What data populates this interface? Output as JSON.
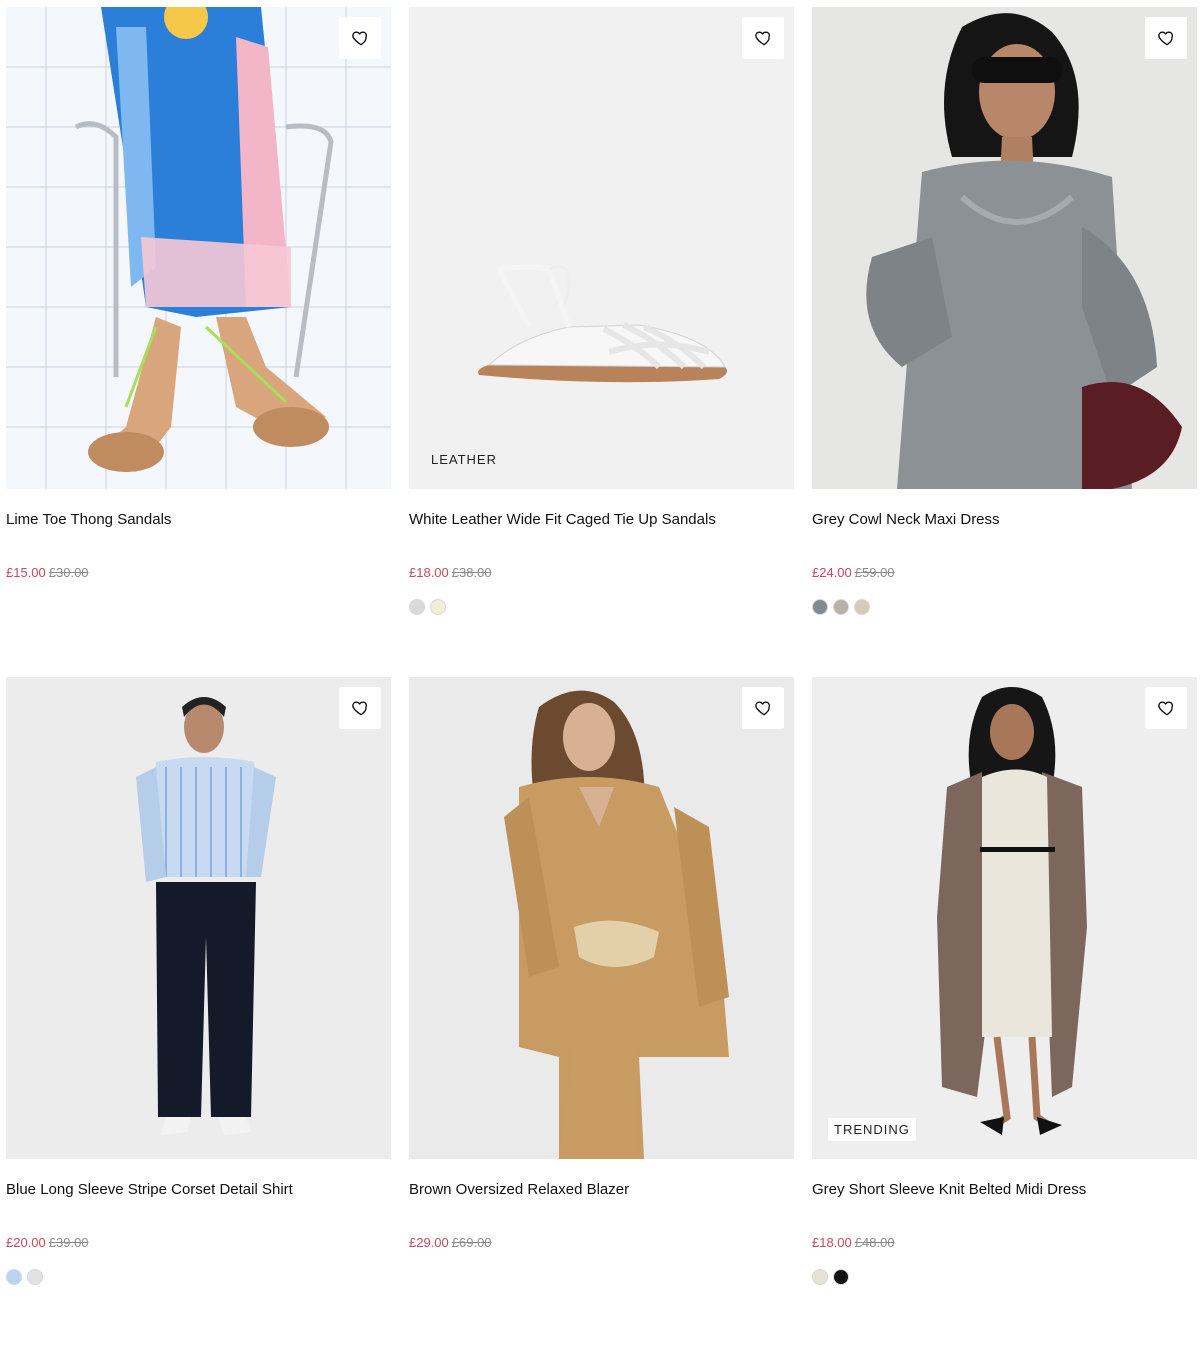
{
  "colors": {
    "sale": "#c9485b",
    "was": "#8a8a8a"
  },
  "products": [
    {
      "title": "Lime Toe Thong Sandals",
      "price": "£15.00",
      "was": "£30.00",
      "badge": "",
      "swatches": [],
      "image": "model-seated-sandals"
    },
    {
      "title": "White Leather Wide Fit Caged Tie Up Sandals",
      "price": "£18.00",
      "was": "£38.00",
      "badge": "LEATHER",
      "swatches": [
        "#d9d9d9",
        "#f2ecd9"
      ],
      "image": "white-caged-sandal"
    },
    {
      "title": "Grey Cowl Neck Maxi Dress",
      "price": "£24.00",
      "was": "£59.00",
      "badge": "",
      "swatches": [
        "#7f8a93",
        "#b9b2a8",
        "#d3ccb9"
      ],
      "image": "model-grey-dress"
    },
    {
      "title": "Blue Long Sleeve Stripe Corset Detail Shirt",
      "price": "£20.00",
      "was": "£39.00",
      "badge": "",
      "swatches": [
        "#b9d4f2",
        "#e0e2e6"
      ],
      "image": "model-blue-shirt"
    },
    {
      "title": "Brown Oversized Relaxed Blazer",
      "price": "£29.00",
      "was": "£69.00",
      "badge": "",
      "swatches": [],
      "image": "model-tan-blazer"
    },
    {
      "title": "Grey Short Sleeve Knit Belted Midi Dress",
      "price": "£18.00",
      "was": "£48.00",
      "badge": "TRENDING",
      "swatches": [
        "#e6e2d6",
        "#111111"
      ],
      "image": "model-knit-dress"
    }
  ]
}
